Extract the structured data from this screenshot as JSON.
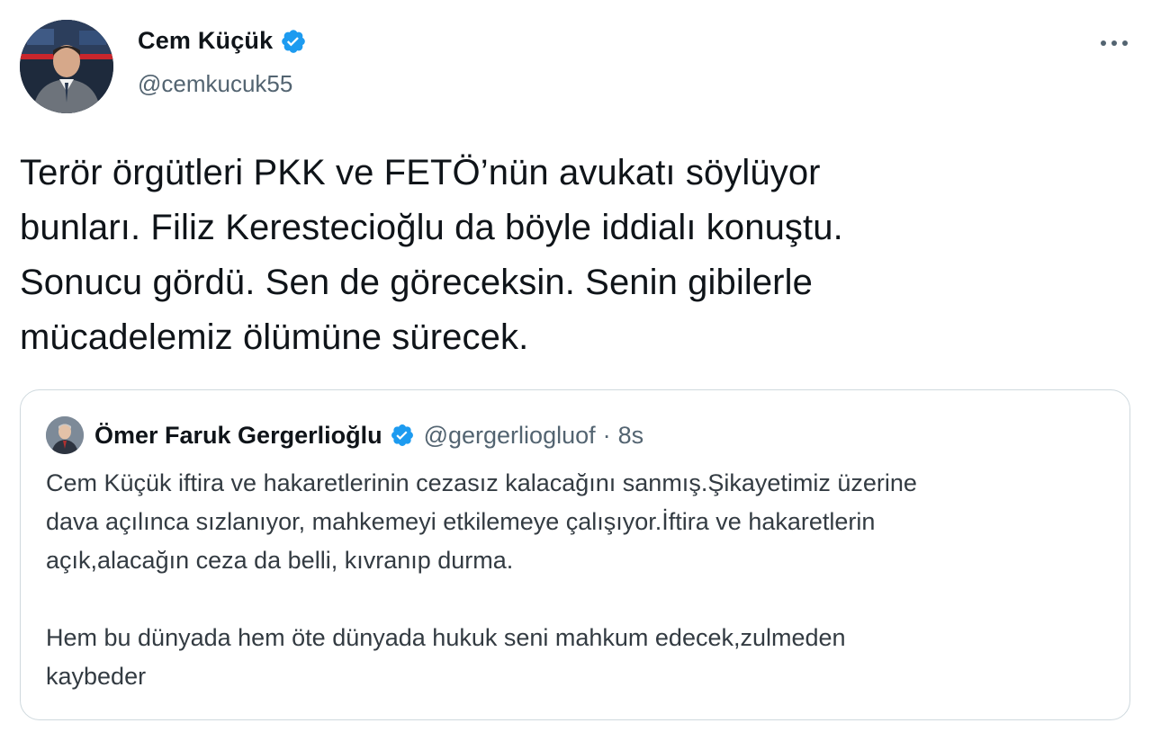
{
  "tweet": {
    "author": {
      "name": "Cem Küçük",
      "handle": "@cemkucuk55",
      "verified": true
    },
    "more_icon": "more-horizontal-icon",
    "text": "Terör örgütleri PKK ve FETÖ’nün avukatı söylüyor\nbunları. Filiz Kerestecioğlu da böyle iddialı konuştu.\nSonucu gördü. Sen de göreceksin. Senin gibilerle\nmücadelemiz ölümüne sürecek."
  },
  "quoted_tweet": {
    "author": {
      "name": "Ömer Faruk Gergerlioğlu",
      "handle": "@gergerliogluof",
      "verified": true
    },
    "separator": "·",
    "time": "8s",
    "text": "Cem Küçük iftira ve hakaretlerinin cezasız kalacağını sanmış.Şikayetimiz üzerine\ndava açılınca sızlanıyor, mahkemeyi etkilemeye çalışıyor.İftira ve hakaretlerin\naçık,alacağın ceza da belli, kıvranıp durma.\n\nHem bu dünyada hem öte dünyada hukuk seni mahkum edecek,zulmeden\nkaybeder"
  },
  "colors": {
    "text_primary": "#0f1419",
    "text_secondary": "#536471",
    "verified_blue": "#1d9bf0",
    "border": "#cfd9de"
  }
}
